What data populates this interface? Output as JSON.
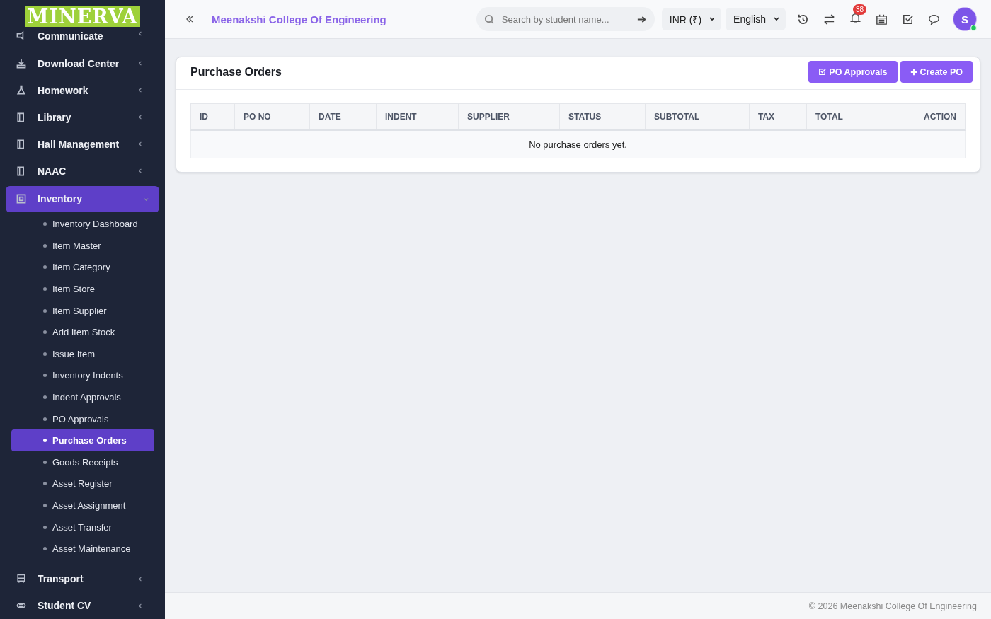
{
  "logo": "MINERVA",
  "sidebar": {
    "items": [
      {
        "label": "Communicate",
        "expanded": false
      },
      {
        "label": "Download Center",
        "expanded": false
      },
      {
        "label": "Homework",
        "expanded": false
      },
      {
        "label": "Library",
        "expanded": false
      },
      {
        "label": "Hall Management",
        "expanded": false
      },
      {
        "label": "NAAC",
        "expanded": false
      },
      {
        "label": "Inventory",
        "expanded": true,
        "children": [
          {
            "label": "Inventory Dashboard",
            "selected": false
          },
          {
            "label": "Item Master",
            "selected": false
          },
          {
            "label": "Item Category",
            "selected": false
          },
          {
            "label": "Item Store",
            "selected": false
          },
          {
            "label": "Item Supplier",
            "selected": false
          },
          {
            "label": "Add Item Stock",
            "selected": false
          },
          {
            "label": "Issue Item",
            "selected": false
          },
          {
            "label": "Inventory Indents",
            "selected": false
          },
          {
            "label": "Indent Approvals",
            "selected": false
          },
          {
            "label": "PO Approvals",
            "selected": false
          },
          {
            "label": "Purchase Orders",
            "selected": true
          },
          {
            "label": "Goods Receipts",
            "selected": false
          },
          {
            "label": "Asset Register",
            "selected": false
          },
          {
            "label": "Asset Assignment",
            "selected": false
          },
          {
            "label": "Asset Transfer",
            "selected": false
          },
          {
            "label": "Asset Maintenance",
            "selected": false
          }
        ]
      },
      {
        "label": "Transport",
        "expanded": false
      },
      {
        "label": "Student CV",
        "expanded": false
      }
    ]
  },
  "topbar": {
    "title": "Meenakshi College Of Engineering",
    "search": {
      "placeholder": "Search by student name..."
    },
    "currency": "INR (₹)",
    "language": "English",
    "notifications": "38",
    "avatar": "S"
  },
  "card": {
    "title": "Purchase Orders",
    "buttons": [
      "PO Approvals",
      "Create PO"
    ],
    "table": {
      "columns": [
        "ID",
        "PO NO",
        "DATE",
        "INDENT",
        "SUPPLIER",
        "STATUS",
        "SUBTOTAL",
        "TAX",
        "TOTAL",
        "ACTION"
      ],
      "empty": "No purchase orders yet."
    }
  },
  "footer": "© 2026 Meenakshi College Of Engineering"
}
